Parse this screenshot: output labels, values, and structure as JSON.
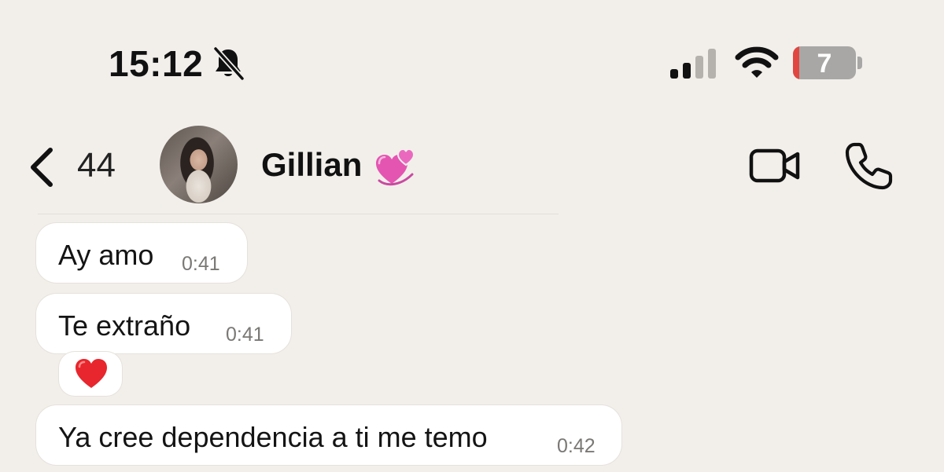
{
  "status_bar": {
    "time": "15:12",
    "battery_level": "7",
    "battery_percent": 7,
    "signal_bars_active": 2,
    "signal_bars_total": 4,
    "icons": [
      "bell-slash-icon",
      "signal-icon",
      "wifi-icon",
      "battery-icon"
    ]
  },
  "header": {
    "back_count": "44",
    "contact_name": "Gillian",
    "name_emoji": "revolving-hearts-icon",
    "actions": [
      "video-call-icon",
      "phone-call-icon"
    ]
  },
  "messages": [
    {
      "text": "Ay amo",
      "time": "0:41"
    },
    {
      "text": "Te extraño",
      "time": "0:41",
      "reaction": "red-heart"
    },
    {
      "text": "Ya cree dependencia a ti me temo",
      "time": "0:42"
    }
  ],
  "colors": {
    "background": "#f2efeb",
    "bubble": "#ffffff",
    "battery_low": "#e2453f",
    "heart_pink": "#e455b2"
  }
}
